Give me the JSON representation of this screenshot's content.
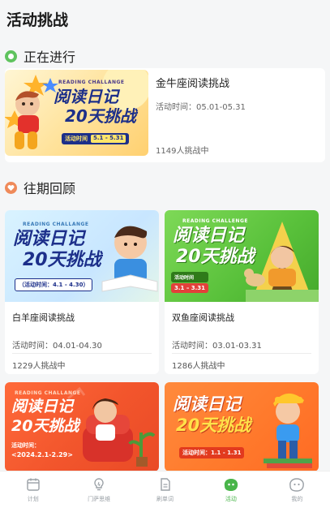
{
  "page": {
    "title": "活动挑战"
  },
  "sections": {
    "ongoing": "正在进行",
    "past": "往期回顾"
  },
  "current": {
    "name": "金牛座阅读挑战",
    "time": "活动时间：05.01-05.31",
    "count": "1149人挑战中",
    "banner": {
      "kicker": "READING CHALLANGE",
      "title_line1": "阅读日记",
      "title_line2": "20天挑战",
      "pill_label": "活动时间",
      "pill_value": "5.1 - 5.31"
    }
  },
  "past": [
    {
      "name": "白羊座阅读挑战",
      "time": "活动时间：04.01-04.30",
      "count": "1229人挑战中",
      "banner": {
        "kicker": "READING CHALLANGE",
        "title_line1": "阅读日记",
        "title_line2": "20天挑战",
        "pill": "（活动时间：4.1 - 4.30）"
      }
    },
    {
      "name": "双鱼座阅读挑战",
      "time": "活动时间：03.01-03.31",
      "count": "1286人挑战中",
      "banner": {
        "kicker": "READING CHALLENGE",
        "title_line1": "阅读日记",
        "title_line2": "20天挑战",
        "pill_label": "活动时间",
        "pill_value": "3.1 – 3.31"
      }
    },
    {
      "banner": {
        "kicker": "READING CHALLANGE",
        "title_line1": "阅读日记",
        "title_line2": "20天挑战",
        "pill_label": "活动时间：",
        "pill_value": "<2024.2.1-2.29>"
      }
    },
    {
      "banner": {
        "title_line1": "阅读日记",
        "title_line2": "20天挑战",
        "pill": "活动时间：1.1 - 1.31"
      }
    }
  ],
  "tabs": [
    {
      "label": "计划",
      "icon": "calendar-icon"
    },
    {
      "label": "门萨思维",
      "icon": "lightbulb-icon"
    },
    {
      "label": "刷单词",
      "icon": "document-icon"
    },
    {
      "label": "活动",
      "icon": "activity-blob-icon",
      "active": true
    },
    {
      "label": "我的",
      "icon": "profile-blob-icon"
    }
  ],
  "colors": {
    "accent_green": "#49b54a",
    "accent_orange": "#ef8a5a",
    "banner_yellow": "#ffd070",
    "banner_blue": "#cfe9ff",
    "banner_green": "#5cc23a",
    "banner_red": "#f2552c"
  }
}
